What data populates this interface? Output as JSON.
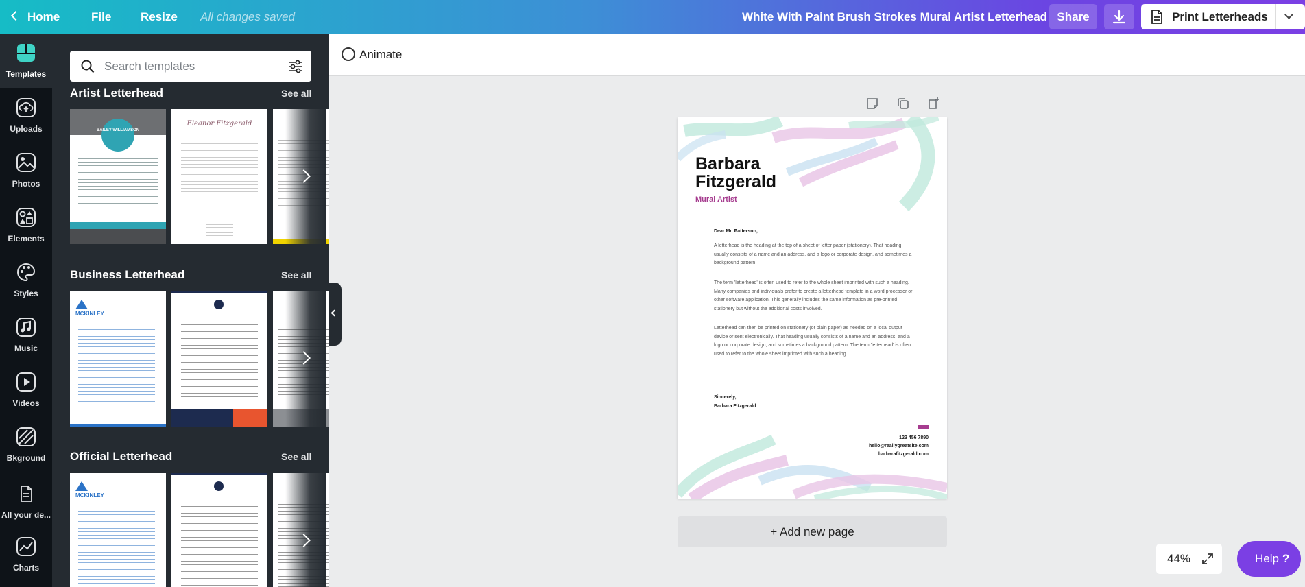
{
  "topbar": {
    "home": "Home",
    "file": "File",
    "resize": "Resize",
    "save_status": "All changes saved",
    "doc_title": "White With Paint Brush Strokes Mural Artist Letterhead",
    "share": "Share",
    "print": "Print Letterheads"
  },
  "rail": {
    "templates": "Templates",
    "uploads": "Uploads",
    "photos": "Photos",
    "elements": "Elements",
    "styles": "Styles",
    "music": "Music",
    "videos": "Videos",
    "background": "Bkground",
    "all_designs": "All your de...",
    "charts": "Charts"
  },
  "panel": {
    "search_placeholder": "Search templates",
    "see_all": "See all",
    "sections": [
      {
        "title": "Artist Letterhead"
      },
      {
        "title": "Business Letterhead"
      },
      {
        "title": "Official Letterhead"
      }
    ]
  },
  "editor": {
    "animate": "Animate",
    "add_page": "+ Add new page",
    "zoom": "44%",
    "help": "Help",
    "help_q": "?"
  },
  "letter": {
    "name_line1": "Barbara",
    "name_line2": "Fitzgerald",
    "role": "Mural Artist",
    "salutation": "Dear Mr. Patterson,",
    "para1": "A letterhead is the heading at the top of a sheet of letter paper (stationery). That heading usually consists of a name and an address, and a logo or corporate design, and sometimes a background pattern.",
    "para2": "The term 'letterhead' is often used to refer to the whole sheet imprinted with such a heading. Many companies and individuals prefer to create a letterhead template in a word processor or other software application. This generally includes the same information as pre-printed stationery but without the additional costs involved.",
    "para3": "Letterhead can then be printed on stationery (or plain paper) as needed on a local output device or sent electronically. That heading usually consists of a name and an address, and a logo or corporate design, and sometimes a background pattern. The term 'letterhead' is often used to refer to the whole sheet imprinted with such a heading.",
    "closing": "Sincerely,",
    "signature": "Barbara Fitzgerald",
    "phone": "123 456 7890",
    "email": "hello@reallygreatsite.com",
    "website": "barbarafitzgerald.com"
  },
  "thumbs": {
    "artist1_name": "BAILEY WILLIAMSON",
    "artist2_name": "Eleanor Fitzgerald",
    "business1_name": "MCKINLEY",
    "official1_name": "MCKINLEY"
  },
  "colors": {
    "accent": "#7b3fe4",
    "teal": "#16bcc6",
    "magenta": "#a63c8f",
    "panel": "#252b31",
    "rail": "#0e1318"
  }
}
